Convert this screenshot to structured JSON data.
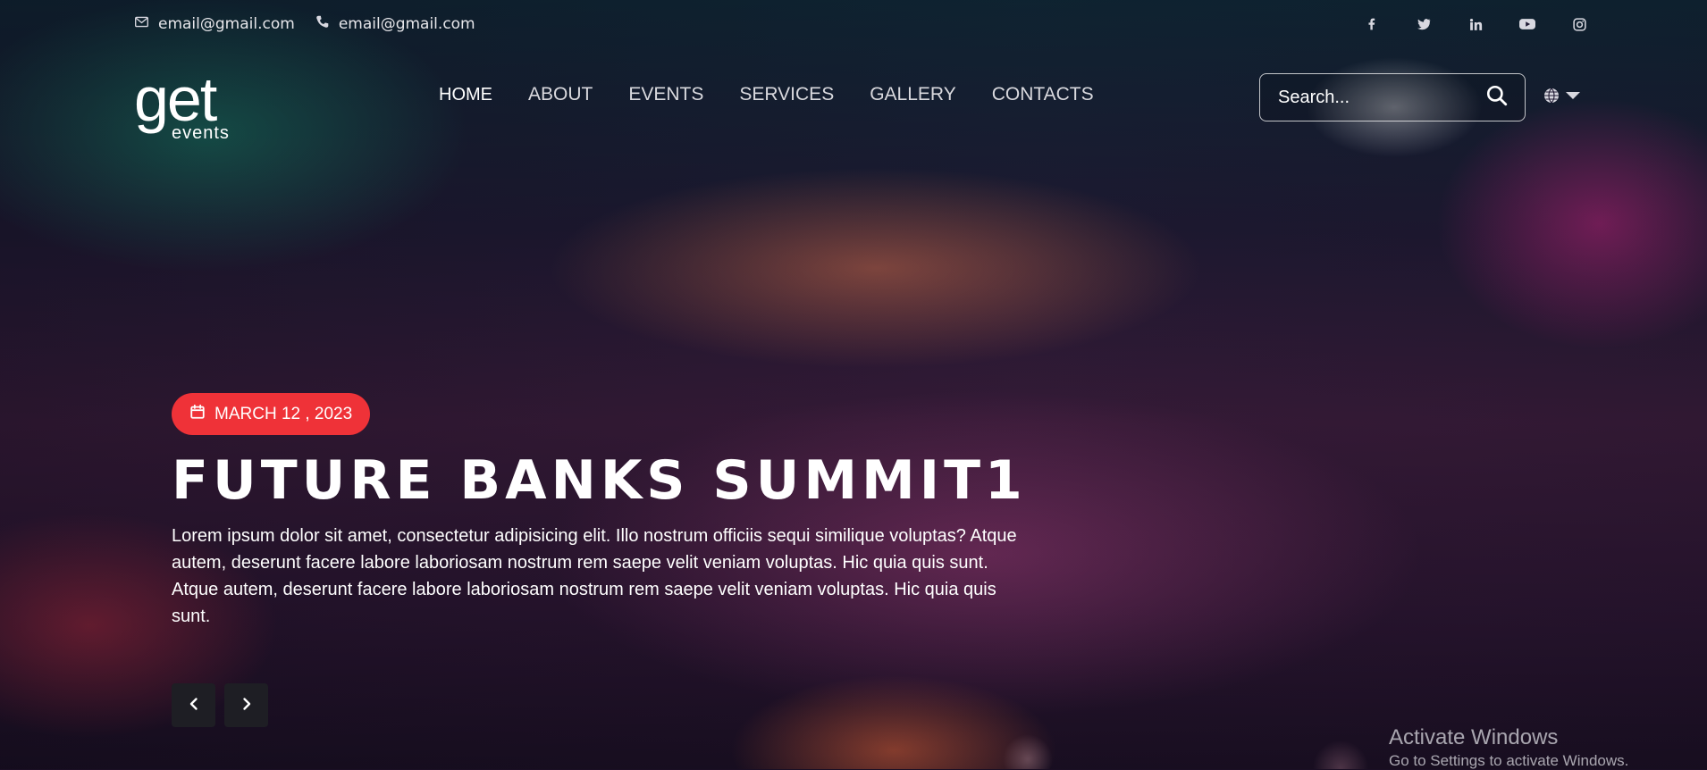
{
  "topbar": {
    "email_1": "email@gmail.com",
    "email_2": "email@gmail.com"
  },
  "social": {
    "icons": [
      "facebook-icon",
      "twitter-icon",
      "linkedin-icon",
      "youtube-icon",
      "instagram-icon"
    ],
    "labels": [
      "f",
      "t",
      "in",
      "yt",
      "ig"
    ]
  },
  "logo": {
    "main": "get",
    "sub": "events"
  },
  "nav": {
    "items": [
      "HOME",
      "ABOUT",
      "EVENTS",
      "SERVICES",
      "GALLERY",
      "CONTACTS"
    ],
    "active": "HOME"
  },
  "search": {
    "placeholder": "Search..."
  },
  "hero": {
    "date": "MARCH 12 , 2023",
    "title": "FUTURE BANKS SUMMIT1",
    "description": "Lorem ipsum dolor sit amet, consectetur adipisicing elit. Illo nostrum officiis sequi similique voluptas? Atque autem, deserunt facere labore laboriosam nostrum rem saepe velit veniam voluptas. Hic quia quis sunt. Atque autem, deserunt facere labore laboriosam nostrum rem saepe velit veniam voluptas. Hic quia quis sunt."
  },
  "watermark": {
    "line1": "Activate Windows",
    "line2": "Go to Settings to activate Windows."
  },
  "colors": {
    "accent": "#ef3238",
    "arrow_bg": "#1e1e24"
  }
}
